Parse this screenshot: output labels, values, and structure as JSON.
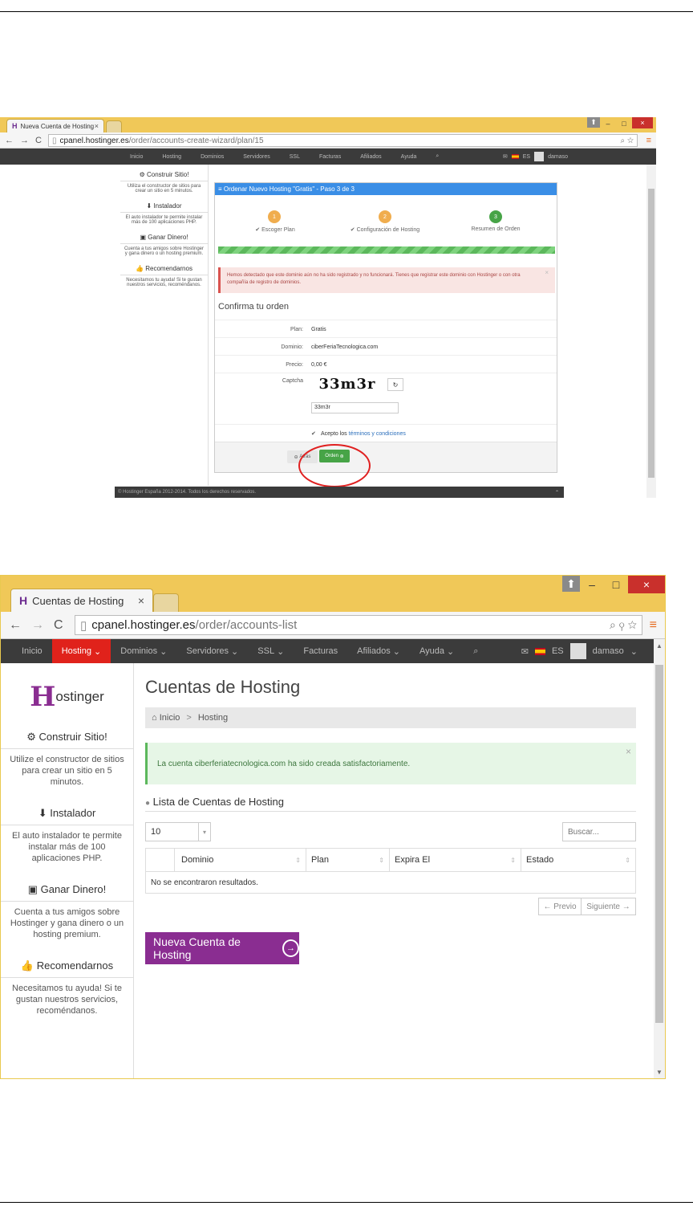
{
  "screenshot1": {
    "tab_title": "Nueva Cuenta de Hosting",
    "url_host": "cpanel.hostinger.es",
    "url_path": "/order/accounts-create-wizard/plan/15",
    "nav": [
      "Inicio",
      "Hosting",
      "Dominios",
      "Servidores",
      "SSL",
      "Facturas",
      "Afiliados",
      "Ayuda"
    ],
    "lang": "ES",
    "user": "damaso",
    "sidebar": [
      {
        "title": "Construir Sitio!",
        "desc": "Utiliza el constructor de sitios para crear un sitio en 5 minutos."
      },
      {
        "title": "Instalador",
        "desc": "El auto instalador te permite instalar más de 100 aplicaciones PHP."
      },
      {
        "title": "Ganar Dinero!",
        "desc": "Cuenta a tus amigos sobre Hostinger y gana dinero o un hosting premium."
      },
      {
        "title": "Recomendarnos",
        "desc": "Necesitamos tu ayuda! Si te gustan nuestros servicios, recoméndanos."
      }
    ],
    "panel_title": "Ordenar Nuevo Hosting \"Gratis\" - Paso 3 de 3",
    "steps": [
      {
        "num": "1",
        "label": "✔ Escoger Plan",
        "color": "#f0ad4e"
      },
      {
        "num": "2",
        "label": "✔ Configuración de Hosting",
        "color": "#f0ad4e"
      },
      {
        "num": "3",
        "label": "Resumen de Orden",
        "color": "#47a447"
      }
    ],
    "alert": "Hemos detectado que este dominio aún no ha sido registrado y no funcionará. Tienes que registrar este dominio con Hostinger o con otra compañía de registro de dominios.",
    "confirm_title": "Confirma tu orden",
    "fields": [
      {
        "label": "Plan:",
        "value": "Gratis"
      },
      {
        "label": "Dominio:",
        "value": "ciberFeriaTecnologica.com"
      },
      {
        "label": "Precio:",
        "value": "0,00 €"
      }
    ],
    "captcha_label": "Captcha",
    "captcha_text": "33m3r",
    "captcha_input": "33m3r",
    "terms_prefix": "Acepto los",
    "terms_link": "términos y condiciones",
    "back_label": "Atrás",
    "order_label": "Orden",
    "footer": "© Hostinger España 2012-2014. Todos los derechos reservados."
  },
  "screenshot2": {
    "tab_title": "Cuentas de Hosting",
    "url_host": "cpanel.hostinger.es",
    "url_path": "/order/accounts-list",
    "nav": [
      "Inicio",
      "Hosting",
      "Dominios",
      "Servidores",
      "SSL",
      "Facturas",
      "Afiliados",
      "Ayuda"
    ],
    "lang": "ES",
    "user": "damaso",
    "logo_text": "ostinger",
    "sidebar": [
      {
        "title": "Construir Sitio!",
        "desc": "Utilize el constructor de sitios para crear un sitio en 5 minutos."
      },
      {
        "title": "Instalador",
        "desc": "El auto instalador te permite instalar más de 100 aplicaciones PHP."
      },
      {
        "title": "Ganar Dinero!",
        "desc": "Cuenta a tus amigos sobre Hostinger y gana dinero o un hosting premium."
      },
      {
        "title": "Recomendarnos",
        "desc": "Necesitamos tu ayuda! Si te gustan nuestros servicios, recoméndanos."
      }
    ],
    "page_title": "Cuentas de Hosting",
    "breadcrumb": [
      "Inicio",
      "Hosting"
    ],
    "success_msg": "La cuenta ciberferiatecnologica.com ha sido creada satisfactoriamente.",
    "list_title": "Lista de Cuentas de Hosting",
    "page_size": "10",
    "search_placeholder": "Buscar...",
    "columns": [
      "Dominio",
      "Plan",
      "Expira El",
      "Estado"
    ],
    "empty_msg": "No se encontraron resultados.",
    "prev_label": "← Previo",
    "next_label": "Siguiente →",
    "new_account_label": "Nueva Cuenta de Hosting"
  },
  "colors": {
    "brand_purple": "#8a2d91",
    "nav_active": "#e0221b",
    "panel_blue": "#3a8ee6",
    "success_green": "#5cb85c"
  }
}
